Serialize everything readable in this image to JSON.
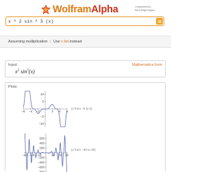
{
  "header": {
    "brand_first": "Wolfram",
    "brand_second": "Alpha",
    "tagline_line1": "computational..",
    "tagline_line2": "knowledge engine"
  },
  "search": {
    "value": "x ^ 2 sin ^ 3 (x)",
    "icon": "equals-icon"
  },
  "assumption": {
    "prefix": "Assuming multiplication",
    "separator": "|",
    "use_text": "Use",
    "link_text": "x list",
    "suffix": "instead"
  },
  "input_pod": {
    "title": "Input:",
    "link": "Mathematica form",
    "expression_base": "x",
    "expression_power1": "2",
    "expression_mid": " sin",
    "expression_power2": "3",
    "expression_tail": "(x)"
  },
  "plots_pod": {
    "title": "Plots:",
    "plot1_label": "(x from −6 to 6)",
    "plot2_label": "(x from −30 to 30)"
  },
  "chart_data": [
    {
      "type": "line",
      "function": "x^2 sin^3(x)",
      "xlim": [
        -6,
        6
      ],
      "ylim": [
        -12,
        12
      ],
      "xticks": [
        "−6",
        "−4",
        "−2",
        "2",
        "4",
        "6"
      ],
      "yticks": [
        "10",
        "5",
        "−5",
        "−10"
      ],
      "color": "#5b6bb5"
    },
    {
      "type": "line",
      "function": "x^2 sin^3(x)",
      "xlim": [
        -30,
        30
      ],
      "ylim": [
        -800,
        800
      ],
      "xticks": [
        "−30",
        "−20",
        "−10",
        "10",
        "20",
        "30"
      ],
      "yticks": [
        "600",
        "400",
        "200",
        "−200",
        "−400",
        "−600",
        "−800"
      ],
      "color": "#5b6bb5"
    }
  ]
}
